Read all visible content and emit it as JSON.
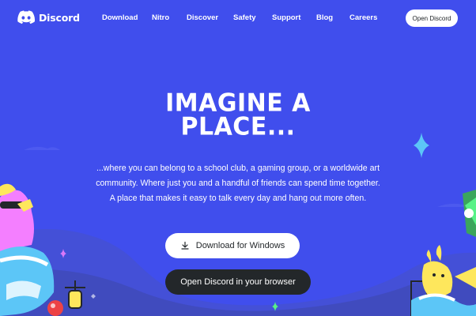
{
  "brand": {
    "name": "Discord",
    "icon": "discord-logo-icon"
  },
  "nav": {
    "links": [
      "Download",
      "Nitro",
      "Discover",
      "Safety",
      "Support",
      "Blog",
      "Careers"
    ],
    "open_button": "Open Discord"
  },
  "hero": {
    "title_line1": "IMAGINE A",
    "title_line2": "PLACE...",
    "text": "...where you can belong to a school club, a gaming group, or a worldwide art community. Where just you and a handful of friends can spend time together. A place that makes it easy to talk every day and hang out more often.",
    "download_button": "Download for Windows",
    "download_icon": "download-icon",
    "browser_button": "Open Discord in your browser"
  },
  "colors": {
    "background": "#404EED",
    "dark_button": "#23272A",
    "white": "#FFFFFF"
  }
}
